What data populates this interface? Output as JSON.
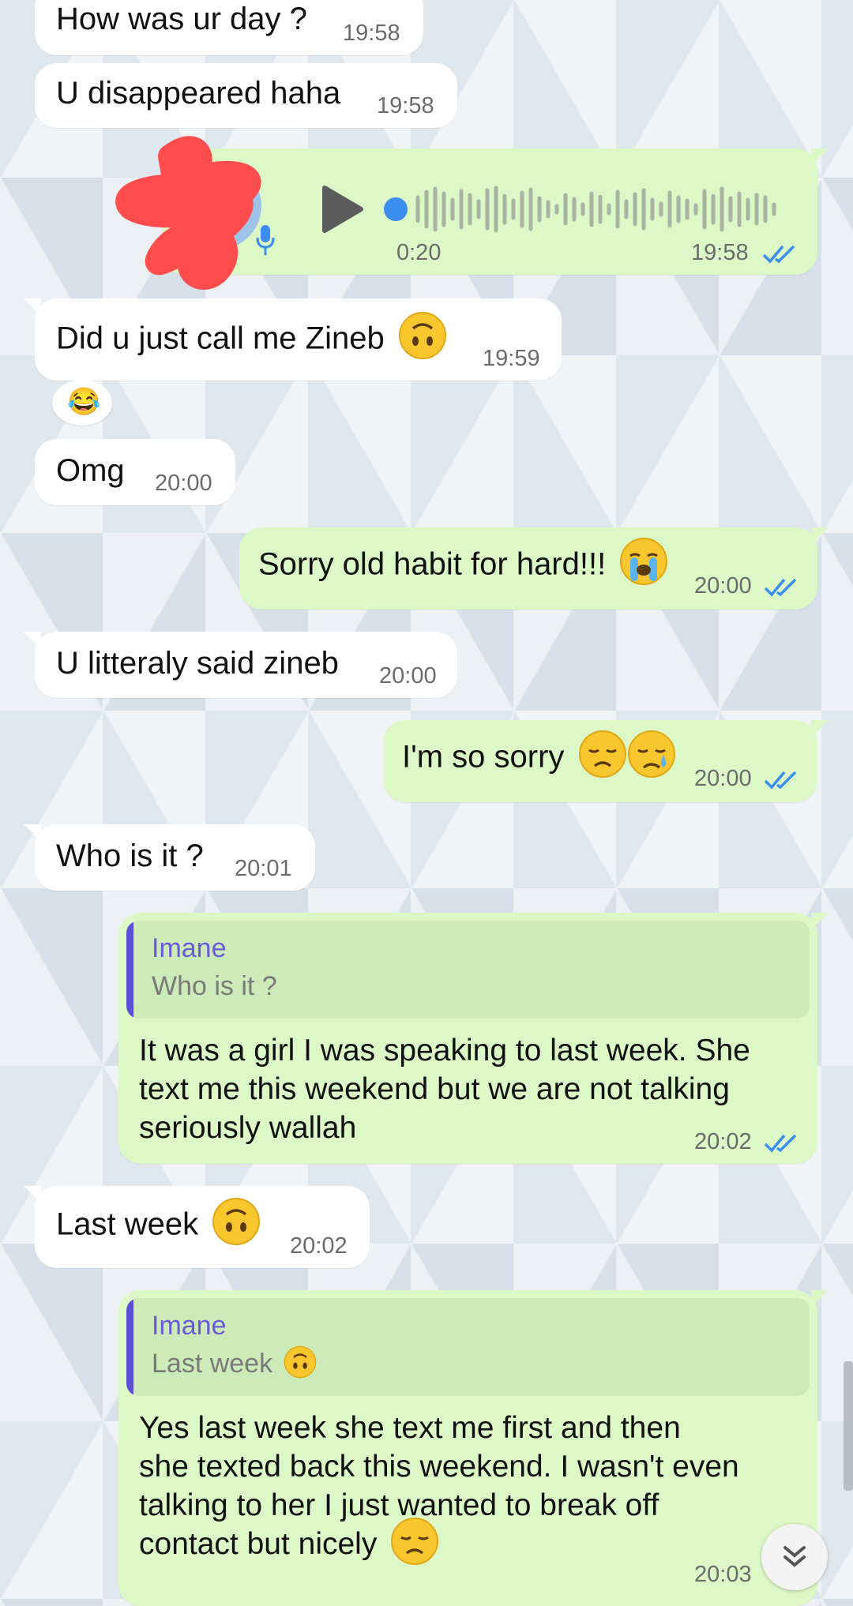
{
  "messages": {
    "m1": {
      "text": "How was ur day ?",
      "time": "19:58"
    },
    "m2": {
      "text": "U disappeared haha",
      "time": "19:58"
    },
    "m3": {
      "duration": "0:20",
      "time": "19:58"
    },
    "m4": {
      "text": "Did u just call me Zineb",
      "time": "19:59",
      "reaction": "😂"
    },
    "m5": {
      "text": "Omg",
      "time": "20:00"
    },
    "m6": {
      "text": "Sorry old habit for hard!!!",
      "time": "20:00"
    },
    "m7": {
      "text": "U litteraly said zineb",
      "time": "20:00"
    },
    "m8": {
      "text": "I'm so sorry",
      "time": "20:00"
    },
    "m9": {
      "text": "Who is it ?",
      "time": "20:01"
    },
    "m10": {
      "quote_name": "Imane",
      "quote_text": "Who is it ?",
      "lines": [
        "It was a girl I was speaking to last week. She",
        "text me this weekend but we are not talking",
        "seriously wallah"
      ],
      "time": "20:02"
    },
    "m11": {
      "text": "Last week",
      "time": "20:02"
    },
    "m12": {
      "quote_name": "Imane",
      "quote_text": "Last week",
      "lines": [
        "Yes last week she text me first and then",
        "she texted back this weekend. I wasn't even",
        "talking to her I just wanted to break off",
        "contact but nicely"
      ],
      "time": "20:03"
    }
  },
  "colors": {
    "incoming_bubble": "#ffffff",
    "outgoing_bubble": "#dcf8c6",
    "read_ticks": "#3b8ef0",
    "quote_accent": "#5b4fd8",
    "redaction": "#ff4d4d"
  },
  "icons": {
    "play": "play-icon",
    "mic": "microphone-icon",
    "ticks": "double-check-icon",
    "scroll_down": "double-chevron-down-icon"
  }
}
